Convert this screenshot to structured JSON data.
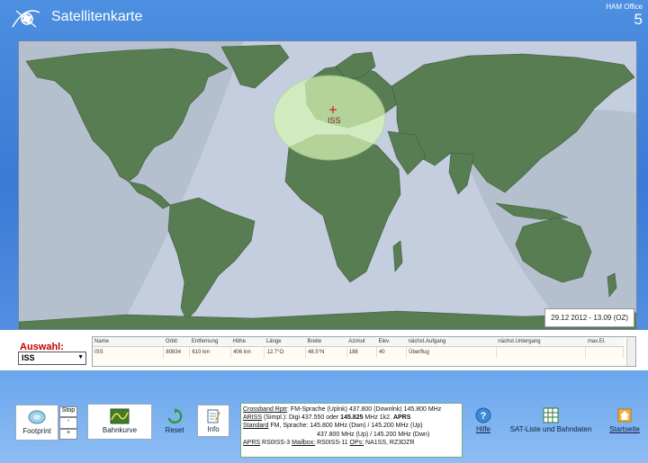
{
  "title_bar": {
    "title": "Satellitenkarte",
    "brand_name": "HAM Office",
    "brand_version": "5",
    "logo_icon": "satellite-logo-icon"
  },
  "map": {
    "timestamp": "29.12 2012 - 13.09 (OZ)",
    "satellite_marker_label": "ISS",
    "colors": {
      "ocean": "#b4c0cd",
      "land": "#597d52",
      "daylight": "#c9d3e4",
      "footprint": "#d6f5b4"
    }
  },
  "selection": {
    "label": "Auswahl:",
    "selected": "ISS",
    "table": {
      "headers": [
        "Name",
        "Orbit",
        "Entfernung",
        "Höhe",
        "Länge",
        "Breite",
        "Azimut",
        "Elev.",
        "nächst.Aufgang",
        "nächst.Untergang",
        "max.El."
      ],
      "rows": [
        [
          "ISS",
          "80834",
          "610 km",
          "406 km",
          "12.7°O",
          "48.5°N",
          "188",
          "40",
          "Überflug",
          "",
          ""
        ]
      ]
    }
  },
  "toolbar": {
    "footprint_label": "Footprint",
    "stop_label": "Stop",
    "minus_label": "-",
    "plus_label": "+",
    "bahnkurve_label": "Bahnkurve",
    "reset_label": "Reset",
    "info_label": "Info",
    "hilfe_label": "Hilfe",
    "satliste_label": "SAT-Liste und Bahndaten",
    "startseite_label": "Startseite"
  },
  "info_box": {
    "l1_key": "Crossband Rptr",
    "l1_val": ": FM-Sprache (Uplnk) 437.800 (Downlnk) 145.800 MHz",
    "l2_key": "ARISS",
    "l2_val": " (Simpl.):  Digi 437.550 oder ",
    "l2_bold": "145.825",
    "l2_val2": " MHz   1k2.  ",
    "l2_bold2": "APRS",
    "l3_key": "Standard",
    "l3_val": " FM, Sprache:  145.800 MHz (Dwn)  /  145.200 MHz  (Up)",
    "l4_val": "437.800 MHz (Up)   /  145.200 MHz (Dwn)",
    "l5_key1": "APRS",
    "l5_val1": "  RS0ISS-3   ",
    "l5_key2": "Mailbox:",
    "l5_val2": " RS0ISS-11   ",
    "l5_key3": "OPs:",
    "l5_val3": " NA1SS, RZ3DZR"
  }
}
